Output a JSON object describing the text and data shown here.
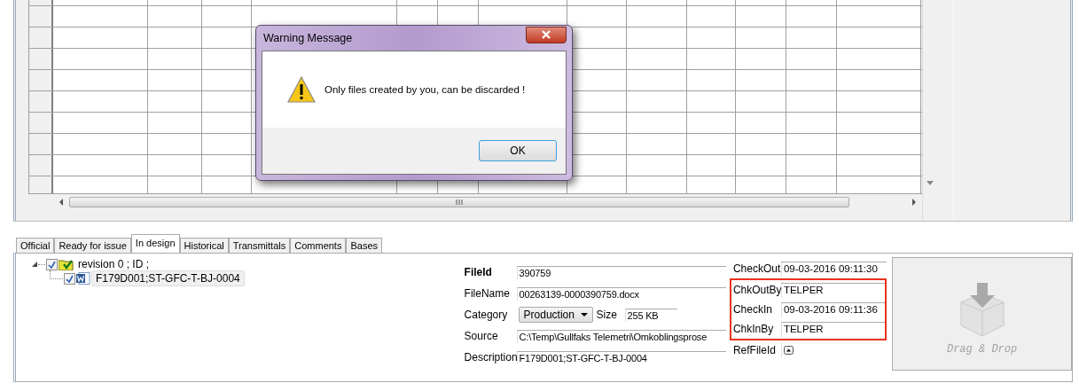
{
  "dialog": {
    "title": "Warning Message",
    "message": "Only files created by you, can be discarded !",
    "button": "OK"
  },
  "tabs": [
    {
      "label": "Official",
      "selected": false
    },
    {
      "label": "Ready for issue",
      "selected": false
    },
    {
      "label": "In design",
      "selected": true
    },
    {
      "label": "Historical",
      "selected": false
    },
    {
      "label": "Transmittals",
      "selected": false
    },
    {
      "label": "Comments",
      "selected": false
    },
    {
      "label": "Bases",
      "selected": false
    }
  ],
  "tree": [
    {
      "label": "revision 0 ; ID ;",
      "checked": true,
      "expanded": true,
      "selected": false,
      "children": [
        {
          "label": "F179D001;ST-GFC-T-BJ-0004",
          "checked": true,
          "selected": true
        }
      ]
    }
  ],
  "details_left": [
    {
      "label": "FileId",
      "value": "390759",
      "kind": "text",
      "bold": true
    },
    {
      "label": "FileName",
      "value": "00263139-0000390759.docx",
      "kind": "text",
      "bold": false
    },
    {
      "label": "Category",
      "value": "Production",
      "kind": "select",
      "bold": false,
      "extra_label": "Size",
      "extra_value": "255 KB"
    },
    {
      "label": "Source",
      "value": "C:\\Temp\\Gullfaks Telemetri\\Omkoblingsprose",
      "kind": "text",
      "bold": false
    },
    {
      "label": "Description",
      "value": "F179D001;ST-GFC-T-BJ-0004",
      "kind": "text",
      "bold": false
    }
  ],
  "details_right": [
    {
      "label": "CheckOut",
      "value": "09-03-2016 09:11:30",
      "kind": "text",
      "highlighted": false
    },
    {
      "label": "ChkOutBy",
      "value": "TELPER",
      "kind": "text",
      "highlighted": true
    },
    {
      "label": "CheckIn",
      "value": "09-03-2016 09:11:36",
      "kind": "text",
      "highlighted": true
    },
    {
      "label": "ChkInBy",
      "value": "TELPER",
      "kind": "text",
      "highlighted": true
    },
    {
      "label": "RefFileId",
      "kind": "spin",
      "highlighted": false
    }
  ],
  "drop_zone": {
    "label": "Drag & Drop"
  }
}
